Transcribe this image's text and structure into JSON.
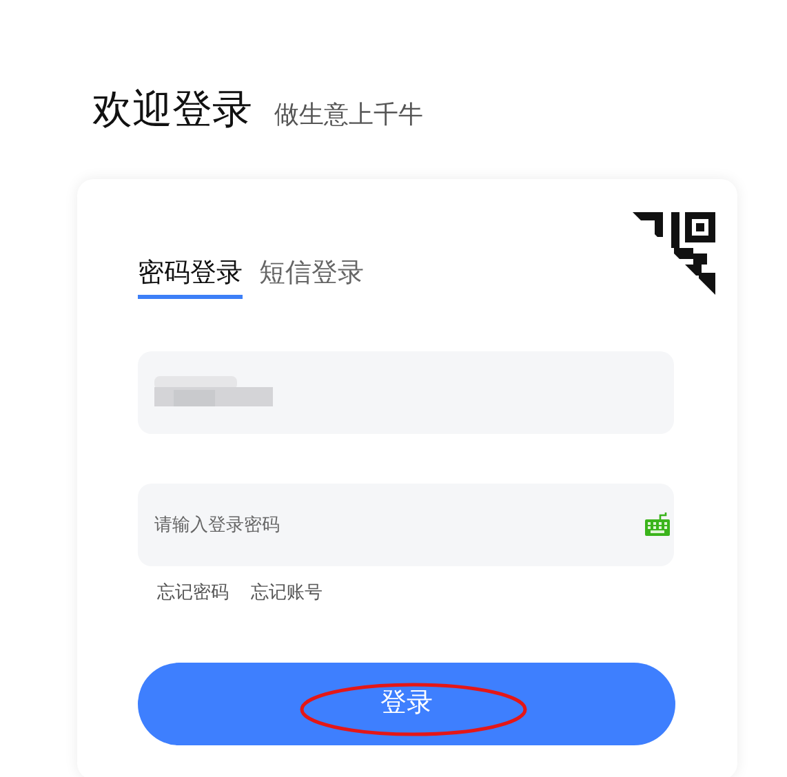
{
  "header": {
    "title": "欢迎登录",
    "subtitle": "做生意上千牛"
  },
  "tabs": [
    {
      "label": "密码登录",
      "selected": true
    },
    {
      "label": "短信登录",
      "selected": false
    }
  ],
  "password_field": {
    "placeholder": "请输入登录密码"
  },
  "links": [
    "忘记密码",
    "忘记账号"
  ],
  "login_button": {
    "label": "登录",
    "circled": true
  }
}
